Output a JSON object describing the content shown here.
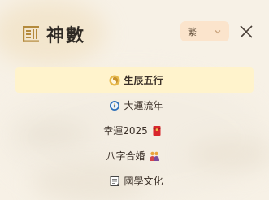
{
  "brand": {
    "name": "神數",
    "logo_icon": "seal-logo-icon"
  },
  "language": {
    "selected": "繁",
    "icon": "chevron-down-icon"
  },
  "close": {
    "icon": "close-icon"
  },
  "menu": {
    "items": [
      {
        "label": "生辰五行",
        "icon": "yin-yang-icon",
        "active": true
      },
      {
        "label": "大運流年",
        "icon": "compass-icon",
        "active": false
      },
      {
        "label": "幸運2025",
        "icon": "red-envelope-icon",
        "active": false
      },
      {
        "label": "八字合婚",
        "icon": "couple-icon",
        "active": false
      },
      {
        "label": "國學文化",
        "icon": "scroll-document-icon",
        "active": false
      }
    ]
  },
  "colors": {
    "active_bg": "#fff3cc",
    "lang_bg": "#fbe4cc",
    "page_bg": "#f7f1e6"
  }
}
